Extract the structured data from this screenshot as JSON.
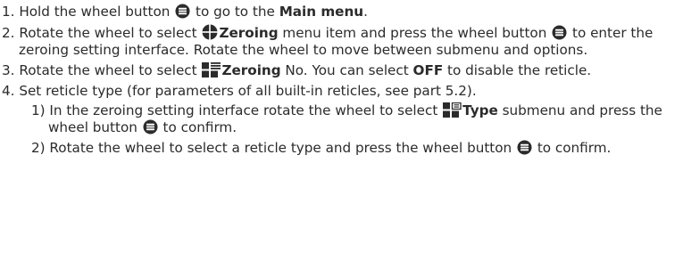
{
  "steps": {
    "s1": {
      "num": "1.",
      "t1": " Hold the wheel button ",
      "t2": " to go to the ",
      "b1": "Main menu",
      "t3": "."
    },
    "s2": {
      "num": "2.",
      "t1": " Rotate the wheel to select ",
      "b1": "Zeroing",
      "t2": " menu item and press the wheel button ",
      "t3": " to enter the zeroing setting interface. Rotate the wheel to move between submenu and options."
    },
    "s3": {
      "num": "3.",
      "t1": " Rotate the wheel to select ",
      "b1": "Zeroing",
      "t2": " No. You can select ",
      "b2": "OFF",
      "t3": " to disable the reticle."
    },
    "s4": {
      "num": "4.",
      "t1": " Set reticle type (for parameters of all built-in reticles, see part 5.2).",
      "sub1": {
        "num": "1)",
        "t1": " In the zeroing setting interface rotate the wheel to select ",
        "b1": "Type",
        "t2": " submenu and press the wheel button ",
        "t3": " to confirm."
      },
      "sub2": {
        "num": "2)",
        "t1": " Rotate the wheel to select a reticle type and press the wheel button ",
        "t2": " to confirm."
      }
    }
  },
  "icons": [
    "menu-wheel-button-icon",
    "zeroing-crosshair-icon",
    "zeroing-number-icon",
    "reticle-type-icon"
  ],
  "colors": {
    "text": "#2b2b2b"
  }
}
